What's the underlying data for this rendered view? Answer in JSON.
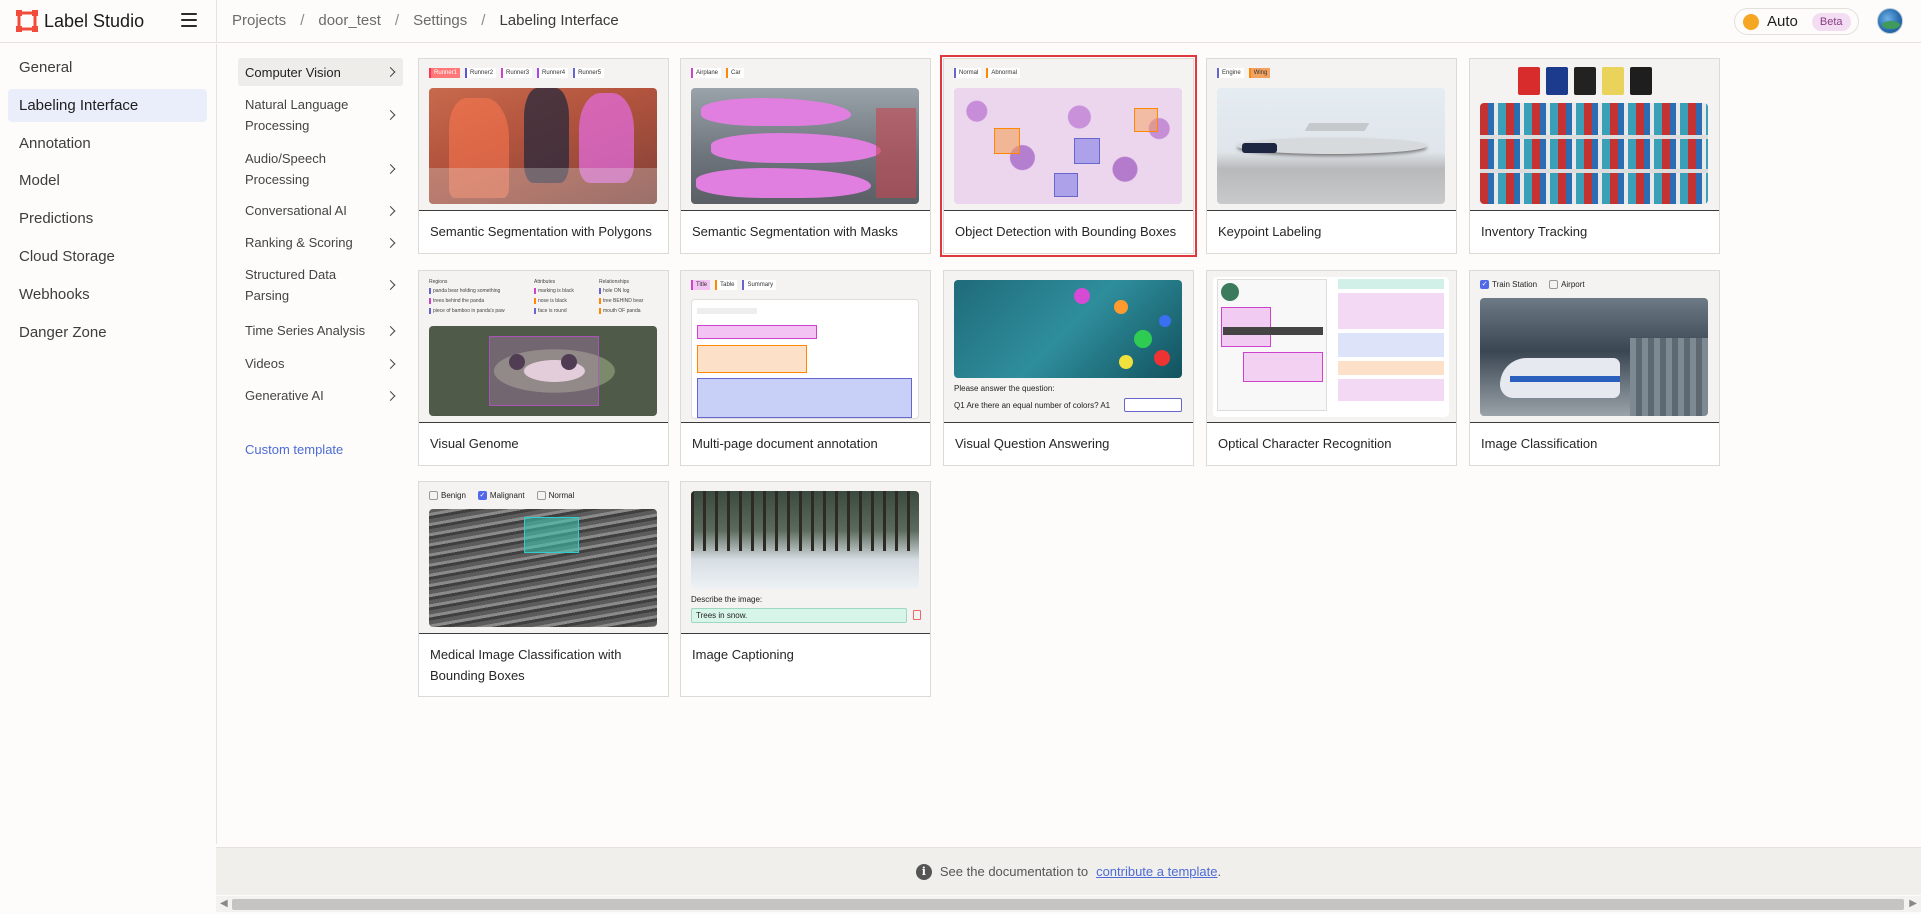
{
  "app": {
    "name": "Label Studio"
  },
  "breadcrumb": [
    "Projects",
    "door_test",
    "Settings",
    "Labeling Interface"
  ],
  "header": {
    "mode_label": "Auto",
    "beta_label": "Beta"
  },
  "settings_nav": [
    {
      "label": "General",
      "active": false
    },
    {
      "label": "Labeling Interface",
      "active": true
    },
    {
      "label": "Annotation",
      "active": false
    },
    {
      "label": "Model",
      "active": false
    },
    {
      "label": "Predictions",
      "active": false
    },
    {
      "label": "Cloud Storage",
      "active": false
    },
    {
      "label": "Webhooks",
      "active": false
    },
    {
      "label": "Danger Zone",
      "active": false
    }
  ],
  "categories": [
    {
      "label": "Computer Vision",
      "active": true
    },
    {
      "label": "Natural Language Processing"
    },
    {
      "label": "Audio/Speech Processing"
    },
    {
      "label": "Conversational AI"
    },
    {
      "label": "Ranking & Scoring"
    },
    {
      "label": "Structured Data Parsing"
    },
    {
      "label": "Time Series Analysis"
    },
    {
      "label": "Videos"
    },
    {
      "label": "Generative AI"
    }
  ],
  "custom_template_label": "Custom template",
  "templates": [
    {
      "title": "Semantic Segmentation with Polygons",
      "labels": [
        "Runner1",
        "Runner2",
        "Runner3",
        "Runner4",
        "Runner5"
      ]
    },
    {
      "title": "Semantic Segmentation with Masks",
      "labels": [
        "Airplane",
        "Car"
      ]
    },
    {
      "title": "Object Detection with Bounding Boxes",
      "labels": [
        "Normal",
        "Abnormal"
      ],
      "selected": true
    },
    {
      "title": "Keypoint Labeling",
      "labels": [
        "Engine",
        "Wing"
      ]
    },
    {
      "title": "Inventory Tracking",
      "labels": []
    },
    {
      "title": "Visual Genome",
      "labels": []
    },
    {
      "title": "Multi-page document annotation",
      "labels": [
        "Title",
        "Table",
        "Summary"
      ]
    },
    {
      "title": "Visual Question Answering",
      "labels": [],
      "vqa_prompt": "Please answer the question:",
      "vqa_question": "Q1   Are there an equal number of colors?   A1"
    },
    {
      "title": "Optical Character Recognition",
      "labels": []
    },
    {
      "title": "Image Classification",
      "labels": [
        "Train Station",
        "Airport"
      ]
    },
    {
      "title": "Medical Image Classification with Bounding Boxes",
      "labels": [
        "Benign",
        "Malignant",
        "Normal"
      ]
    },
    {
      "title": "Image Captioning",
      "labels": [],
      "caption_prompt": "Describe the image:",
      "caption_value": "Trees in snow."
    }
  ],
  "footer": {
    "prefix": "See the documentation to",
    "link": "contribute a template",
    "suffix": "."
  }
}
